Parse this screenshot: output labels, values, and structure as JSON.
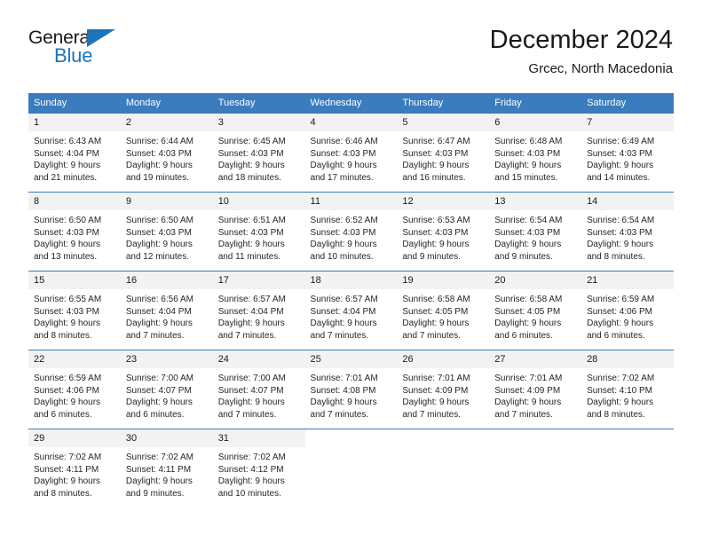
{
  "brand": {
    "name_top": "General",
    "name_bottom": "Blue",
    "triangle_color": "#1b75bb",
    "text_color": "#1a1a1a"
  },
  "header": {
    "title": "December 2024",
    "subtitle": "Grcec, North Macedonia"
  },
  "theme": {
    "header_bg": "#3a7cbe",
    "header_text": "#ffffff",
    "daynum_bg": "#f2f2f2",
    "row_border": "#3a7cbe",
    "body_text": "#262626"
  },
  "weekday_headers": [
    "Sunday",
    "Monday",
    "Tuesday",
    "Wednesday",
    "Thursday",
    "Friday",
    "Saturday"
  ],
  "weeks": [
    [
      {
        "day": "1",
        "sunrise": "Sunrise: 6:43 AM",
        "sunset": "Sunset: 4:04 PM",
        "daylight_1": "Daylight: 9 hours",
        "daylight_2": "and 21 minutes."
      },
      {
        "day": "2",
        "sunrise": "Sunrise: 6:44 AM",
        "sunset": "Sunset: 4:03 PM",
        "daylight_1": "Daylight: 9 hours",
        "daylight_2": "and 19 minutes."
      },
      {
        "day": "3",
        "sunrise": "Sunrise: 6:45 AM",
        "sunset": "Sunset: 4:03 PM",
        "daylight_1": "Daylight: 9 hours",
        "daylight_2": "and 18 minutes."
      },
      {
        "day": "4",
        "sunrise": "Sunrise: 6:46 AM",
        "sunset": "Sunset: 4:03 PM",
        "daylight_1": "Daylight: 9 hours",
        "daylight_2": "and 17 minutes."
      },
      {
        "day": "5",
        "sunrise": "Sunrise: 6:47 AM",
        "sunset": "Sunset: 4:03 PM",
        "daylight_1": "Daylight: 9 hours",
        "daylight_2": "and 16 minutes."
      },
      {
        "day": "6",
        "sunrise": "Sunrise: 6:48 AM",
        "sunset": "Sunset: 4:03 PM",
        "daylight_1": "Daylight: 9 hours",
        "daylight_2": "and 15 minutes."
      },
      {
        "day": "7",
        "sunrise": "Sunrise: 6:49 AM",
        "sunset": "Sunset: 4:03 PM",
        "daylight_1": "Daylight: 9 hours",
        "daylight_2": "and 14 minutes."
      }
    ],
    [
      {
        "day": "8",
        "sunrise": "Sunrise: 6:50 AM",
        "sunset": "Sunset: 4:03 PM",
        "daylight_1": "Daylight: 9 hours",
        "daylight_2": "and 13 minutes."
      },
      {
        "day": "9",
        "sunrise": "Sunrise: 6:50 AM",
        "sunset": "Sunset: 4:03 PM",
        "daylight_1": "Daylight: 9 hours",
        "daylight_2": "and 12 minutes."
      },
      {
        "day": "10",
        "sunrise": "Sunrise: 6:51 AM",
        "sunset": "Sunset: 4:03 PM",
        "daylight_1": "Daylight: 9 hours",
        "daylight_2": "and 11 minutes."
      },
      {
        "day": "11",
        "sunrise": "Sunrise: 6:52 AM",
        "sunset": "Sunset: 4:03 PM",
        "daylight_1": "Daylight: 9 hours",
        "daylight_2": "and 10 minutes."
      },
      {
        "day": "12",
        "sunrise": "Sunrise: 6:53 AM",
        "sunset": "Sunset: 4:03 PM",
        "daylight_1": "Daylight: 9 hours",
        "daylight_2": "and 9 minutes."
      },
      {
        "day": "13",
        "sunrise": "Sunrise: 6:54 AM",
        "sunset": "Sunset: 4:03 PM",
        "daylight_1": "Daylight: 9 hours",
        "daylight_2": "and 9 minutes."
      },
      {
        "day": "14",
        "sunrise": "Sunrise: 6:54 AM",
        "sunset": "Sunset: 4:03 PM",
        "daylight_1": "Daylight: 9 hours",
        "daylight_2": "and 8 minutes."
      }
    ],
    [
      {
        "day": "15",
        "sunrise": "Sunrise: 6:55 AM",
        "sunset": "Sunset: 4:03 PM",
        "daylight_1": "Daylight: 9 hours",
        "daylight_2": "and 8 minutes."
      },
      {
        "day": "16",
        "sunrise": "Sunrise: 6:56 AM",
        "sunset": "Sunset: 4:04 PM",
        "daylight_1": "Daylight: 9 hours",
        "daylight_2": "and 7 minutes."
      },
      {
        "day": "17",
        "sunrise": "Sunrise: 6:57 AM",
        "sunset": "Sunset: 4:04 PM",
        "daylight_1": "Daylight: 9 hours",
        "daylight_2": "and 7 minutes."
      },
      {
        "day": "18",
        "sunrise": "Sunrise: 6:57 AM",
        "sunset": "Sunset: 4:04 PM",
        "daylight_1": "Daylight: 9 hours",
        "daylight_2": "and 7 minutes."
      },
      {
        "day": "19",
        "sunrise": "Sunrise: 6:58 AM",
        "sunset": "Sunset: 4:05 PM",
        "daylight_1": "Daylight: 9 hours",
        "daylight_2": "and 7 minutes."
      },
      {
        "day": "20",
        "sunrise": "Sunrise: 6:58 AM",
        "sunset": "Sunset: 4:05 PM",
        "daylight_1": "Daylight: 9 hours",
        "daylight_2": "and 6 minutes."
      },
      {
        "day": "21",
        "sunrise": "Sunrise: 6:59 AM",
        "sunset": "Sunset: 4:06 PM",
        "daylight_1": "Daylight: 9 hours",
        "daylight_2": "and 6 minutes."
      }
    ],
    [
      {
        "day": "22",
        "sunrise": "Sunrise: 6:59 AM",
        "sunset": "Sunset: 4:06 PM",
        "daylight_1": "Daylight: 9 hours",
        "daylight_2": "and 6 minutes."
      },
      {
        "day": "23",
        "sunrise": "Sunrise: 7:00 AM",
        "sunset": "Sunset: 4:07 PM",
        "daylight_1": "Daylight: 9 hours",
        "daylight_2": "and 6 minutes."
      },
      {
        "day": "24",
        "sunrise": "Sunrise: 7:00 AM",
        "sunset": "Sunset: 4:07 PM",
        "daylight_1": "Daylight: 9 hours",
        "daylight_2": "and 7 minutes."
      },
      {
        "day": "25",
        "sunrise": "Sunrise: 7:01 AM",
        "sunset": "Sunset: 4:08 PM",
        "daylight_1": "Daylight: 9 hours",
        "daylight_2": "and 7 minutes."
      },
      {
        "day": "26",
        "sunrise": "Sunrise: 7:01 AM",
        "sunset": "Sunset: 4:09 PM",
        "daylight_1": "Daylight: 9 hours",
        "daylight_2": "and 7 minutes."
      },
      {
        "day": "27",
        "sunrise": "Sunrise: 7:01 AM",
        "sunset": "Sunset: 4:09 PM",
        "daylight_1": "Daylight: 9 hours",
        "daylight_2": "and 7 minutes."
      },
      {
        "day": "28",
        "sunrise": "Sunrise: 7:02 AM",
        "sunset": "Sunset: 4:10 PM",
        "daylight_1": "Daylight: 9 hours",
        "daylight_2": "and 8 minutes."
      }
    ],
    [
      {
        "day": "29",
        "sunrise": "Sunrise: 7:02 AM",
        "sunset": "Sunset: 4:11 PM",
        "daylight_1": "Daylight: 9 hours",
        "daylight_2": "and 8 minutes."
      },
      {
        "day": "30",
        "sunrise": "Sunrise: 7:02 AM",
        "sunset": "Sunset: 4:11 PM",
        "daylight_1": "Daylight: 9 hours",
        "daylight_2": "and 9 minutes."
      },
      {
        "day": "31",
        "sunrise": "Sunrise: 7:02 AM",
        "sunset": "Sunset: 4:12 PM",
        "daylight_1": "Daylight: 9 hours",
        "daylight_2": "and 10 minutes."
      },
      {
        "day": "",
        "sunrise": "",
        "sunset": "",
        "daylight_1": "",
        "daylight_2": ""
      },
      {
        "day": "",
        "sunrise": "",
        "sunset": "",
        "daylight_1": "",
        "daylight_2": ""
      },
      {
        "day": "",
        "sunrise": "",
        "sunset": "",
        "daylight_1": "",
        "daylight_2": ""
      },
      {
        "day": "",
        "sunrise": "",
        "sunset": "",
        "daylight_1": "",
        "daylight_2": ""
      }
    ]
  ]
}
